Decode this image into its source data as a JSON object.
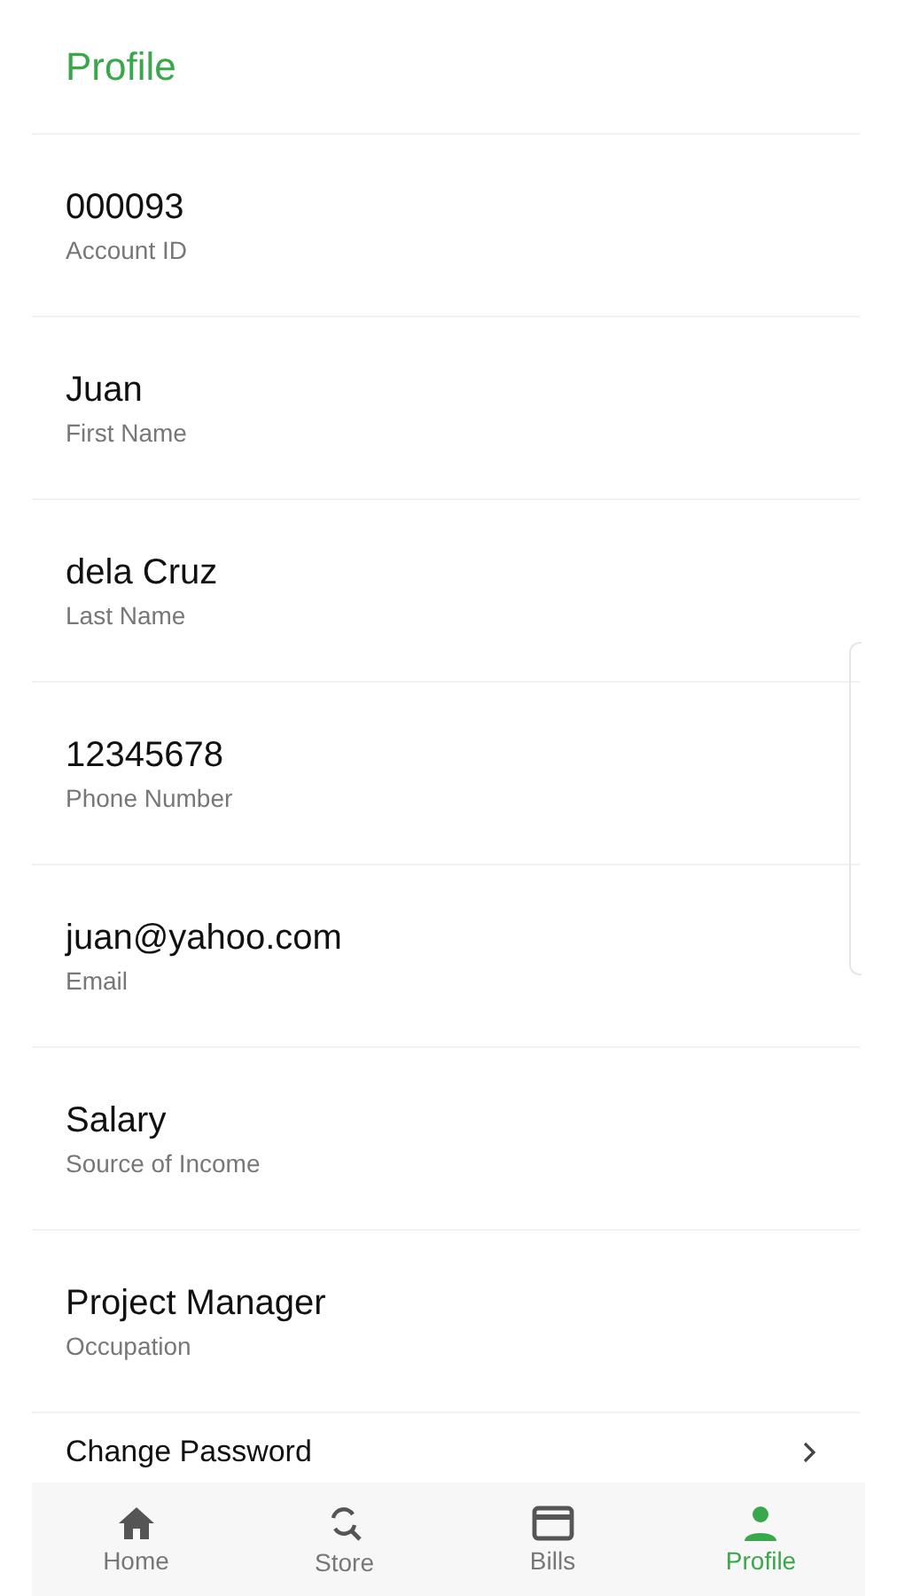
{
  "header": {
    "title": "Profile"
  },
  "fields": [
    {
      "value": "000093",
      "label": "Account ID"
    },
    {
      "value": "Juan",
      "label": "First Name"
    },
    {
      "value": "dela Cruz",
      "label": "Last Name"
    },
    {
      "value": "12345678",
      "label": "Phone Number"
    },
    {
      "value": "juan@yahoo.com",
      "label": "Email"
    },
    {
      "value": "Salary",
      "label": "Source of Income"
    },
    {
      "value": "Project Manager",
      "label": "Occupation"
    }
  ],
  "actions": [
    {
      "label": "Change Password"
    }
  ],
  "bottom_nav": [
    {
      "label": "Home",
      "kind": "home",
      "selected": false
    },
    {
      "label": "Store",
      "kind": "store",
      "selected": false
    },
    {
      "label": "Bills",
      "kind": "bills",
      "selected": false
    },
    {
      "label": "Profile",
      "kind": "profile",
      "selected": true
    }
  ]
}
